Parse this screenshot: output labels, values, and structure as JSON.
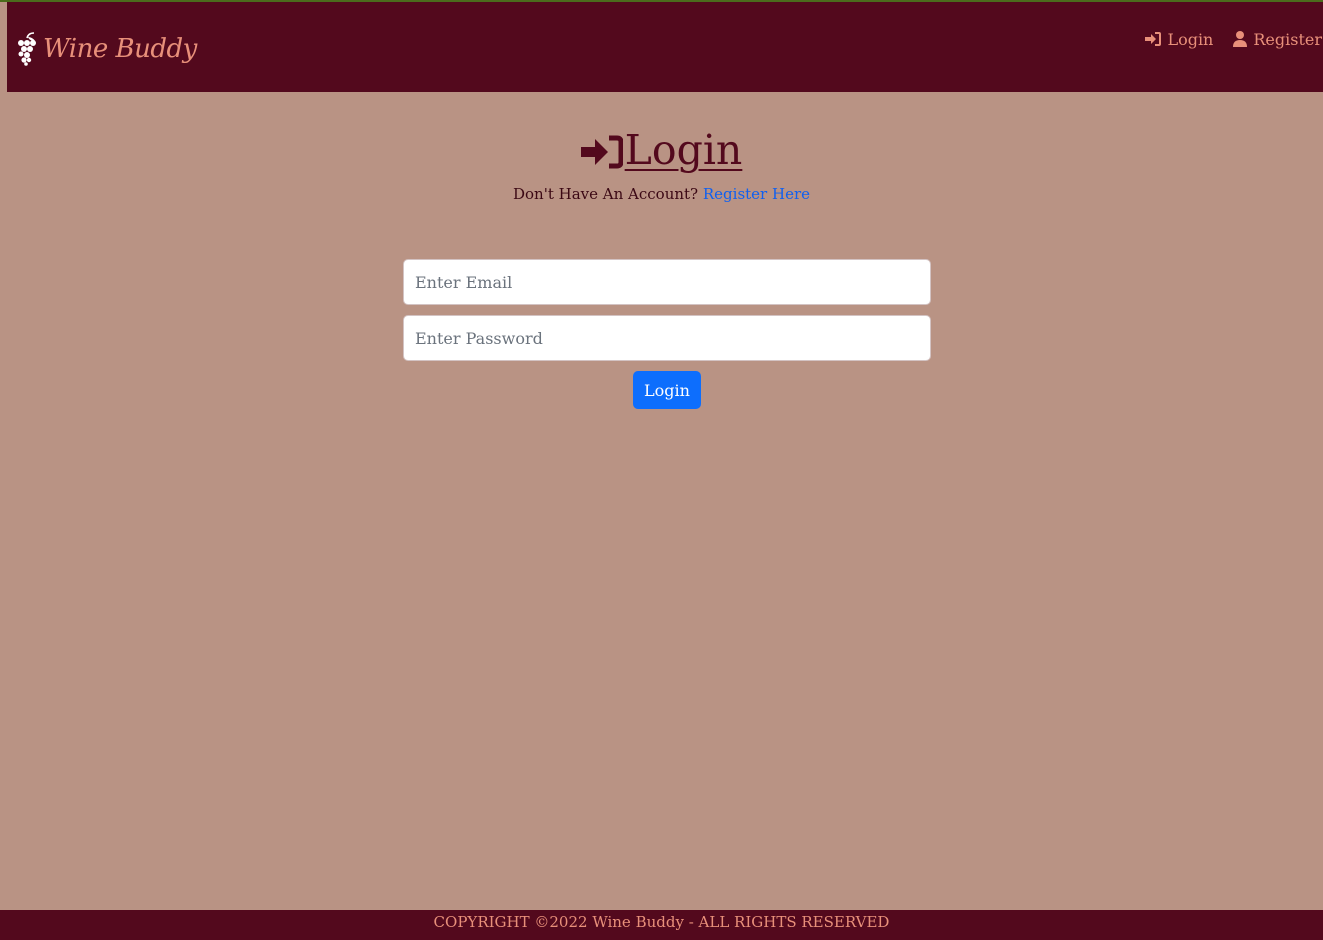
{
  "navbar": {
    "brand_name": "Wine Buddy",
    "brand_icon": "grapes-icon",
    "links": [
      {
        "label": "Login",
        "icon": "sign-in-icon"
      },
      {
        "label": "Register",
        "icon": "user-icon"
      }
    ]
  },
  "main": {
    "title": " Login",
    "title_icon": "sign-in-icon",
    "prompt_text": "Don't Have An Account?",
    "register_link": "Register Here"
  },
  "form": {
    "email": {
      "value": "",
      "placeholder": "Enter Email"
    },
    "password": {
      "value": "",
      "placeholder": "Enter Password"
    },
    "submit_label": "Login"
  },
  "footer": {
    "text": "COPYRIGHT ©2022 Wine Buddy - ALL RIGHTS RESERVED"
  },
  "colors": {
    "navbar_bg": "#53091d",
    "page_bg": "#b99384",
    "accent": "#e8907a",
    "button": "#0d6efd",
    "link": "#1060f0"
  }
}
